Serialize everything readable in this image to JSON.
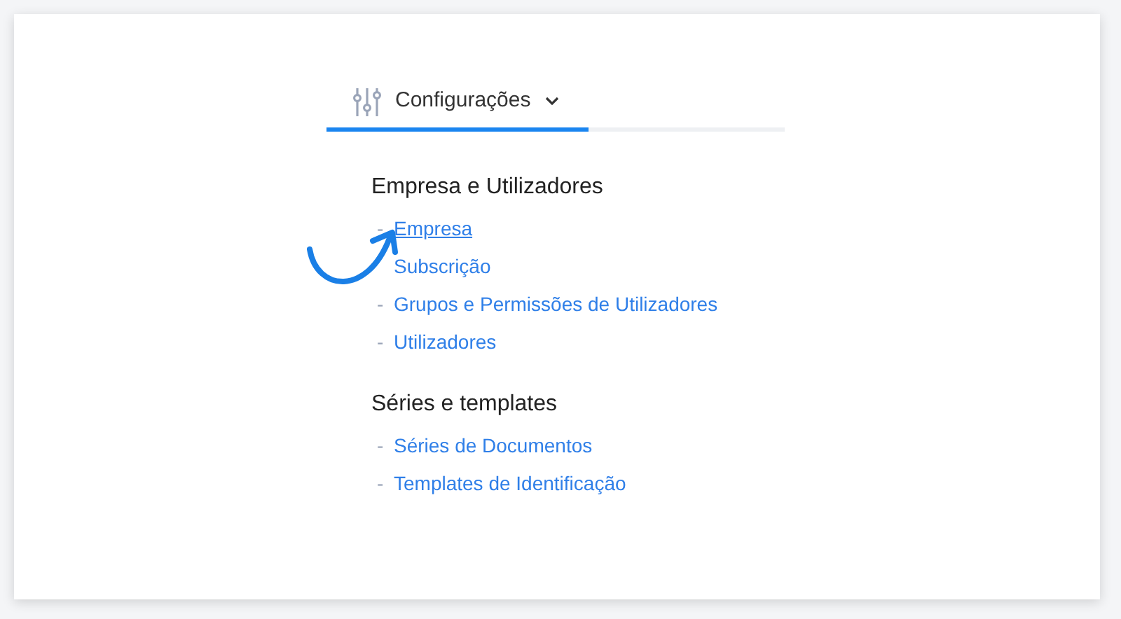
{
  "tabs": [
    {
      "label": "Configurações",
      "selected": true
    }
  ],
  "sections": [
    {
      "title": "Empresa e Utilizadores",
      "items": [
        {
          "marker": "-",
          "label": "Empresa",
          "hovered": true
        },
        {
          "label": "Subscrição",
          "hovered": false
        },
        {
          "marker": "-",
          "label": "Grupos e Permissões de Utilizadores",
          "hovered": false
        },
        {
          "marker": "-",
          "label": "Utilizadores",
          "hovered": false
        }
      ]
    },
    {
      "title": "Séries e templates",
      "items": [
        {
          "marker": "-",
          "label": "Séries de Documentos",
          "hovered": false
        },
        {
          "marker": "-",
          "label": "Templates de Identificação",
          "hovered": false
        }
      ]
    }
  ]
}
